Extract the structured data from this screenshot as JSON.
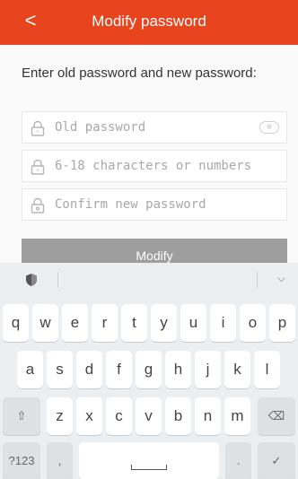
{
  "header": {
    "title": "Modify password",
    "back_glyph": "<"
  },
  "instructions": "Enter old password and new password:",
  "fields": [
    {
      "placeholder": "Old password",
      "icon": "lock-icon"
    },
    {
      "placeholder": "6-18 characters or numbers",
      "icon": "lock-icon"
    },
    {
      "placeholder": "Confirm new password",
      "icon": "lock-icon"
    }
  ],
  "modify_button": "Modify",
  "keyboard": {
    "row1": [
      "q",
      "w",
      "e",
      "r",
      "t",
      "y",
      "u",
      "i",
      "o",
      "p"
    ],
    "row2": [
      "a",
      "s",
      "d",
      "f",
      "g",
      "h",
      "j",
      "k",
      "l"
    ],
    "row3": [
      "z",
      "x",
      "c",
      "v",
      "b",
      "n",
      "m"
    ],
    "shift_glyph": "⇧",
    "backspace_glyph": "⌫",
    "symbols_label": "?123",
    "comma": ",",
    "period": ".",
    "enter_glyph": "✓",
    "collapse_glyph": "⌵"
  }
}
